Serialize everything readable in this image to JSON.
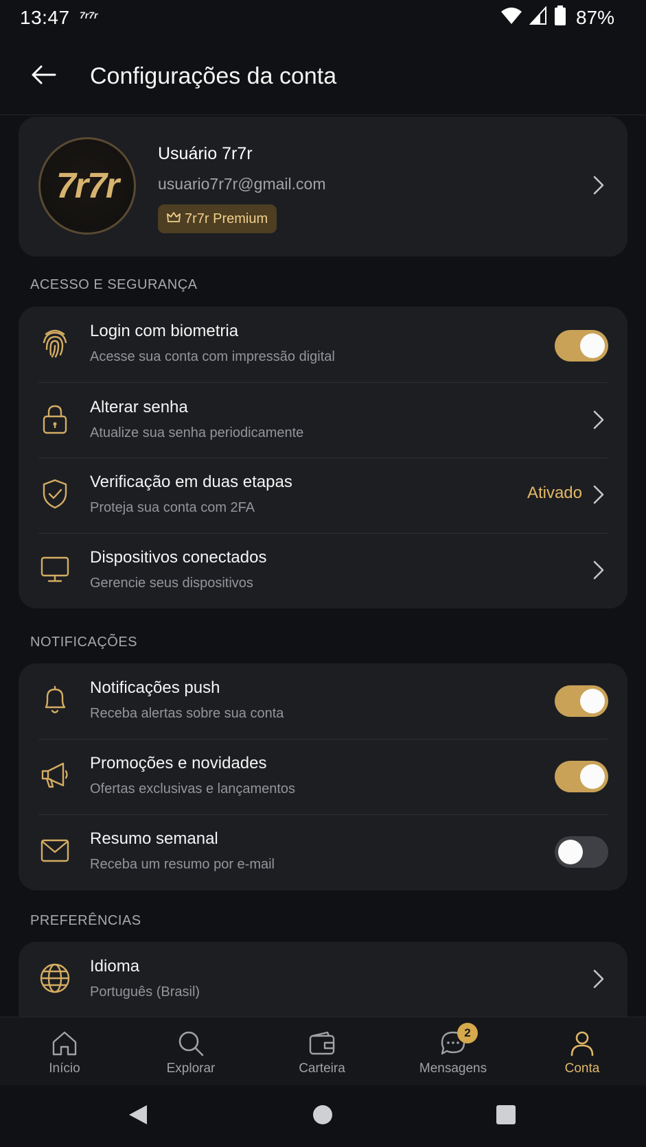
{
  "status_bar": {
    "time": "13:47",
    "app_logo": "7r7r",
    "battery": "87%",
    "icons": [
      "wifi-icon",
      "signal-icon",
      "battery-icon"
    ]
  },
  "header": {
    "title": "Configurações da conta",
    "back_icon": "arrow-left-icon"
  },
  "profile": {
    "avatar_text": "7r7r",
    "name": "Usuário 7r7r",
    "email": "usuario7r7r@gmail.com",
    "badge": "7r7r Premium"
  },
  "sections": {
    "security": {
      "label": "ACESSO E SEGURANÇA",
      "items": [
        {
          "title": "Login com biometria",
          "subtitle": "Acesse sua conta com impressão digital",
          "icon": "fingerprint-icon",
          "toggle": true
        },
        {
          "title": "Alterar senha",
          "subtitle": "Atualize sua senha periodicamente",
          "icon": "lock-icon"
        },
        {
          "title": "Verificação em duas etapas",
          "subtitle": "Proteja sua conta com 2FA",
          "icon": "shield-check-icon",
          "status": "Ativado"
        },
        {
          "title": "Dispositivos conectados",
          "subtitle": "Gerencie seus dispositivos",
          "icon": "monitor-icon"
        }
      ]
    },
    "notifications": {
      "label": "NOTIFICAÇÕES",
      "items": [
        {
          "title": "Notificações push",
          "subtitle": "Receba alertas sobre sua conta",
          "icon": "bell-icon",
          "toggle": true
        },
        {
          "title": "Promoções e novidades",
          "subtitle": "Ofertas exclusivas e lançamentos",
          "icon": "megaphone-icon",
          "toggle": true
        },
        {
          "title": "Resumo semanal",
          "subtitle": "Receba um resumo por e-mail",
          "icon": "mail-icon",
          "toggle": false
        }
      ]
    },
    "preferences": {
      "label": "PREFERÊNCIAS",
      "items": [
        {
          "title": "Idioma",
          "subtitle": "Português (Brasil)",
          "icon": "globe-icon"
        }
      ]
    }
  },
  "bottom_nav": {
    "items": [
      {
        "label": "Início",
        "icon": "home-icon"
      },
      {
        "label": "Explorar",
        "icon": "search-icon"
      },
      {
        "label": "Carteira",
        "icon": "wallet-icon"
      },
      {
        "label": "Mensagens",
        "icon": "chat-icon",
        "badge": "2"
      },
      {
        "label": "Conta",
        "icon": "user-icon",
        "active": true
      }
    ]
  },
  "colors": {
    "accent": "#e0b769",
    "toggle_on": "#c9a257",
    "card": "#1d1e22",
    "background": "#101114"
  }
}
